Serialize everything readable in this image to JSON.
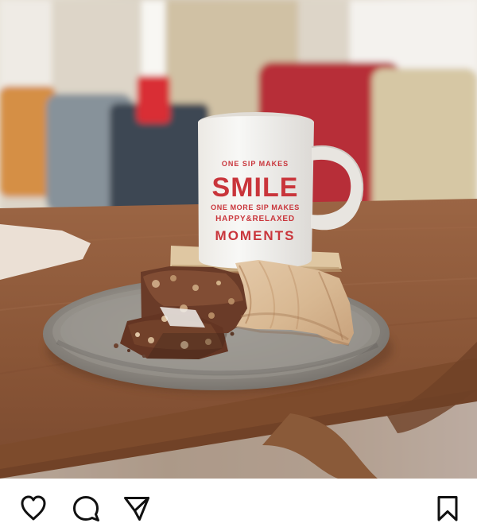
{
  "post": {
    "image": {
      "mug_text": {
        "line1": "ONE SIP MAKES",
        "line2": "SMILE",
        "line3": "ONE MORE SIP MAKES",
        "line4": "HAPPY&RELAXED",
        "line5": "MOMENTS"
      }
    },
    "actions": [
      {
        "name": "like",
        "icon": "heart-outline-icon"
      },
      {
        "name": "comment",
        "icon": "speech-bubble-icon"
      },
      {
        "name": "share",
        "icon": "paper-plane-icon"
      },
      {
        "name": "save",
        "icon": "bookmark-outline-icon"
      }
    ]
  },
  "colors": {
    "icon": "#111111",
    "mug_text": "#c9353b",
    "table": "#8a5637"
  }
}
